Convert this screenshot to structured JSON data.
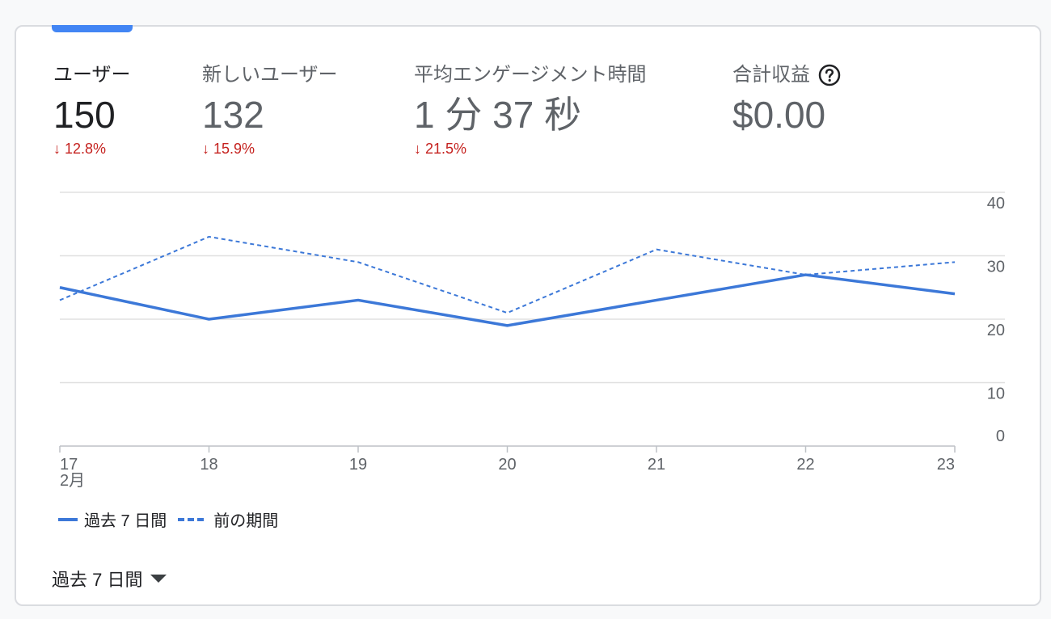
{
  "metrics": [
    {
      "label": "ユーザー",
      "value": "150",
      "change": "↓ 12.8%"
    },
    {
      "label": "新しいユーザー",
      "value": "132",
      "change": "↓ 15.9%"
    },
    {
      "label": "平均エンゲージメント時間",
      "value": "1 分 37 秒",
      "change": "↓ 21.5%"
    },
    {
      "label": "合計収益",
      "value": "$0.00",
      "help_icon": "help-circle-icon"
    }
  ],
  "chart_data": {
    "type": "line",
    "x": [
      "17",
      "18",
      "19",
      "20",
      "21",
      "22",
      "23"
    ],
    "x_sublabel": "2月",
    "ylim": [
      0,
      40
    ],
    "y_ticks": [
      "0",
      "10",
      "20",
      "30",
      "40"
    ],
    "grid": true,
    "series": [
      {
        "name": "過去 7 日間",
        "style": "solid",
        "values": [
          25,
          20,
          23,
          19,
          23,
          27,
          24
        ]
      },
      {
        "name": "前の期間",
        "style": "dashed",
        "values": [
          23,
          33,
          29,
          21,
          31,
          27,
          29
        ]
      }
    ]
  },
  "legend": {
    "current": "過去 7 日間",
    "previous": "前の期間"
  },
  "date_range": {
    "label": "過去 7 日間"
  },
  "colors": {
    "accent": "#4285f4",
    "line": "#3c78d8",
    "negative": "#c5221f"
  }
}
